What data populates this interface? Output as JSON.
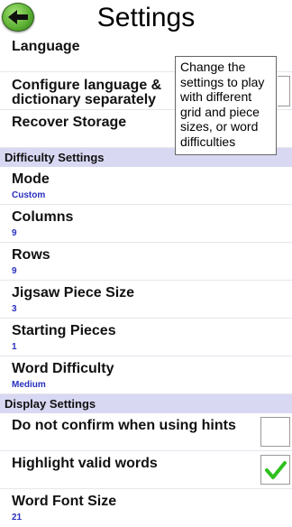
{
  "header": {
    "title": "Settings"
  },
  "general": {
    "language_label": "Language",
    "configure_line1": "Configure language &",
    "configure_line2": "dictionary separately",
    "recover_label": "Recover Storage"
  },
  "tooltip": {
    "text": "Change the settings to play with different grid and piece sizes, or word difficulties"
  },
  "difficulty": {
    "header": "Difficulty Settings",
    "items": [
      {
        "label": "Mode",
        "value": "Custom"
      },
      {
        "label": "Columns",
        "value": "9"
      },
      {
        "label": "Rows",
        "value": "9"
      },
      {
        "label": "Jigsaw Piece Size",
        "value": "3"
      },
      {
        "label": "Starting Pieces",
        "value": "1"
      },
      {
        "label": "Word Difficulty",
        "value": "Medium"
      }
    ]
  },
  "display": {
    "header": "Display Settings",
    "hints_label": "Do not confirm when using hints",
    "hints_checked": false,
    "highlight_label": "Highlight valid words",
    "highlight_checked": true,
    "font_label": "Word Font Size",
    "font_value": "21"
  },
  "colors": {
    "section_bg": "#d8d8f3",
    "value_text": "#2a2fbf",
    "check_green": "#2fc01f",
    "back_button": "#5fb335"
  },
  "icons": {
    "back": "back-arrow-icon",
    "check": "checkmark-icon"
  }
}
